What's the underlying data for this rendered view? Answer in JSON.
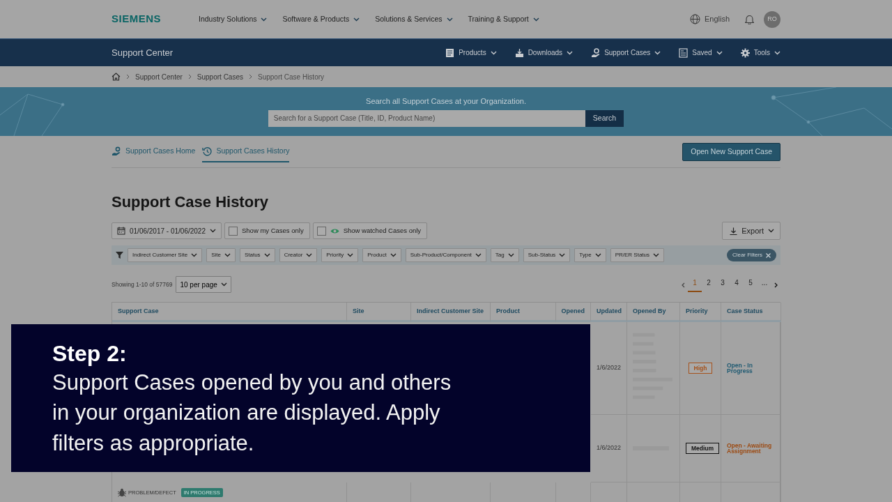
{
  "top_nav": {
    "logo": "SIEMENS",
    "menu": [
      {
        "label": "Industry Solutions"
      },
      {
        "label": "Software & Products"
      },
      {
        "label": "Solutions & Services"
      },
      {
        "label": "Training & Support"
      }
    ],
    "language": "English",
    "avatar": "RO"
  },
  "sub_nav": {
    "title": "Support Center",
    "menu": [
      {
        "label": "Products"
      },
      {
        "label": "Downloads"
      },
      {
        "label": "Support Cases"
      },
      {
        "label": "Saved"
      },
      {
        "label": "Tools"
      }
    ]
  },
  "breadcrumbs": [
    "Support Center",
    "Support Cases",
    "Support Case History"
  ],
  "search_banner": {
    "prompt": "Search all Support Cases at your Organization.",
    "placeholder": "Search for a Support Case (Title, ID, Product Name)",
    "button": "Search"
  },
  "tabs": [
    {
      "label": "Support Cases Home",
      "selected": false
    },
    {
      "label": "Support Cases History",
      "selected": true
    }
  ],
  "open_button": "Open New Support Case",
  "heading": "Support Case History",
  "date_range": "01/06/2017 - 01/06/2022",
  "toggles": [
    {
      "label": "Show my Cases only",
      "checked": false
    },
    {
      "label": "Show watched Cases only",
      "checked": false
    }
  ],
  "export": "Export",
  "filters": [
    "Indirect Customer Site",
    "Site",
    "Status",
    "Creator",
    "Priority",
    "Product",
    "Sub-Product/Component",
    "Tag",
    "Sub-Status",
    "Type",
    "PR/ER Status"
  ],
  "clear_filters": "Clear Filters",
  "showing": "Showing 1-10 of 57769",
  "per_page": "10 per page",
  "pagination": [
    {
      "label": "1",
      "selected": true
    },
    {
      "label": "2",
      "selected": false
    },
    {
      "label": "3",
      "selected": false
    },
    {
      "label": "4",
      "selected": false
    },
    {
      "label": "5",
      "selected": false
    },
    {
      "label": "...",
      "selected": false
    }
  ],
  "table": {
    "columns": [
      "Support Case",
      "Site",
      "Indirect Customer Site",
      "Product",
      "Opened",
      "Updated",
      "Opened By",
      "Priority",
      "Case Status"
    ],
    "rows": [
      {
        "updated": "1/6/2022",
        "priority": {
          "text": "High",
          "color": "#a5521c"
        },
        "status": {
          "text": "Open - In Progress",
          "color": "#1f5a72"
        }
      },
      {
        "updated": "1/6/2022",
        "priority": {
          "text": "Medium",
          "color": "#111111"
        },
        "status": {
          "text": "Open - Awaiting Assignment",
          "color": "#9c4a12"
        }
      },
      {
        "case_type": "PROBLEM/DEFECT",
        "badge": "IN PROGRESS"
      }
    ]
  },
  "caption": {
    "title": "Step 2:",
    "text": "Support Cases opened by you and others in your organization are displayed. Apply filters as appropriate."
  }
}
